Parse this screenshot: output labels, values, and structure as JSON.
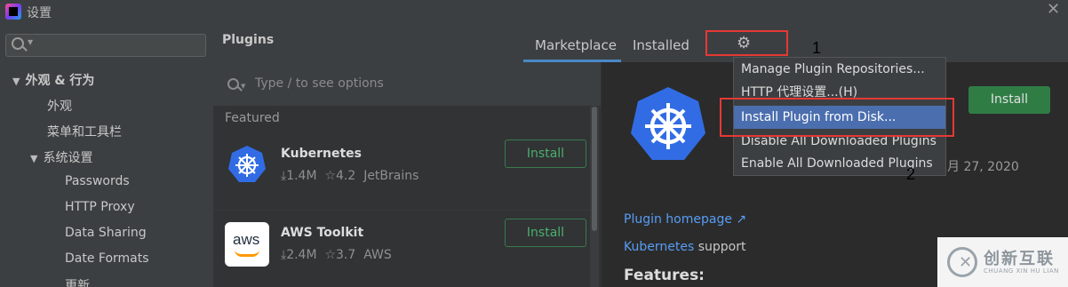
{
  "window": {
    "title": "设置",
    "close_glyph": "✕"
  },
  "sidebar": {
    "search_placeholder": "",
    "items": [
      {
        "label": "外观 & 行为",
        "expanded": true
      },
      {
        "label": "外观"
      },
      {
        "label": "菜单和工具栏"
      },
      {
        "label": "系统设置",
        "expanded": true
      },
      {
        "label": "Passwords"
      },
      {
        "label": "HTTP Proxy"
      },
      {
        "label": "Data Sharing"
      },
      {
        "label": "Date Formats"
      },
      {
        "label": "更新"
      }
    ]
  },
  "header": {
    "title": "Plugins",
    "tabs": [
      {
        "label": "Marketplace",
        "active": true
      },
      {
        "label": "Installed"
      }
    ],
    "gear_icon": "gear-icon"
  },
  "plugin_list": {
    "search_placeholder": "Type / to see options",
    "section_label": "Featured",
    "plugins": [
      {
        "name": "Kubernetes",
        "downloads": "1.4M",
        "rating": "4.2",
        "vendor": "JetBrains",
        "install_label": "Install"
      },
      {
        "name": "AWS Toolkit",
        "downloads": "2.4M",
        "rating": "3.7",
        "vendor": "AWS",
        "install_label": "Install",
        "logo_text": "aws"
      }
    ]
  },
  "details": {
    "install_label": "Install",
    "date_fragment": "月 27, 2020",
    "homepage_link": "Plugin homepage ↗",
    "description_link": "Kubernetes",
    "description_rest": " support",
    "features_heading": "Features:"
  },
  "menu": {
    "items": [
      {
        "label": "Manage Plugin Repositories..."
      },
      {
        "label": "HTTP 代理设置...(H)"
      },
      {
        "label": "Install Plugin from Disk...",
        "selected": true
      },
      {
        "label": "Disable All Downloaded Plugins"
      },
      {
        "label": "Enable All Downloaded Plugins"
      }
    ]
  },
  "annotations": {
    "one": "1",
    "two": "2"
  },
  "watermark": {
    "text": "创新互联",
    "sub": "CHUANG XIN HU LIAN"
  },
  "colors": {
    "accent": "#4a88c7",
    "selection": "#4b6eaf",
    "install_green": "#2f7d45",
    "highlight_red": "#e53935",
    "kubernetes_blue": "#326ce5"
  }
}
